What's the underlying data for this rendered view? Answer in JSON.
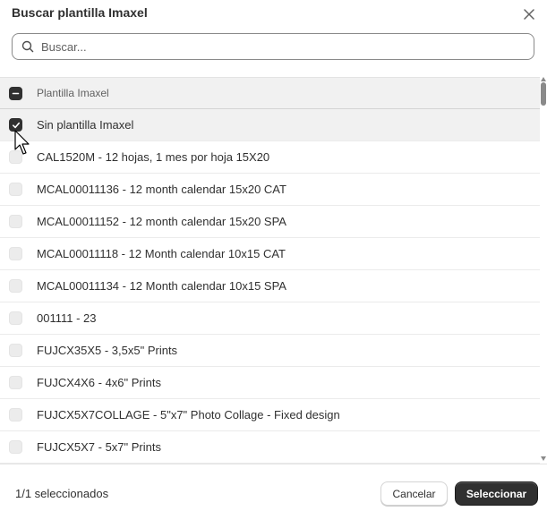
{
  "dialog": {
    "title": "Buscar plantilla Imaxel",
    "close_icon": "close-icon"
  },
  "search": {
    "placeholder": "Buscar...",
    "value": "",
    "icon": "search-icon"
  },
  "table": {
    "header_label": "Plantilla Imaxel",
    "header_checkbox_state": "indeterminate",
    "rows": [
      {
        "label": "Sin plantilla Imaxel",
        "checked": true
      },
      {
        "label": "CAL1520M - 12 hojas, 1 mes por hoja 15X20",
        "checked": false
      },
      {
        "label": "MCAL00011136 - 12 month calendar 15x20 CAT",
        "checked": false
      },
      {
        "label": "MCAL00011152 - 12 month calendar 15x20 SPA",
        "checked": false
      },
      {
        "label": "MCAL00011118 - 12 Month calendar 10x15 CAT",
        "checked": false
      },
      {
        "label": "MCAL00011134 - 12 Month calendar 10x15 SPA",
        "checked": false
      },
      {
        "label": "001111 - 23",
        "checked": false
      },
      {
        "label": "FUJCX35X5 - 3,5x5\" Prints",
        "checked": false
      },
      {
        "label": "FUJCX4X6 - 4x6\" Prints",
        "checked": false
      },
      {
        "label": "FUJCX5X7COLLAGE - 5\"x7\" Photo Collage - Fixed design",
        "checked": false
      },
      {
        "label": "FUJCX5X7 - 5x7\" Prints",
        "checked": false
      }
    ]
  },
  "footer": {
    "selected_count": "1/1 seleccionados",
    "cancel_label": "Cancelar",
    "select_label": "Seleccionar"
  },
  "colors": {
    "primary_button": "#303030",
    "selected_row": "#f1f1f1",
    "text": "#303030"
  }
}
